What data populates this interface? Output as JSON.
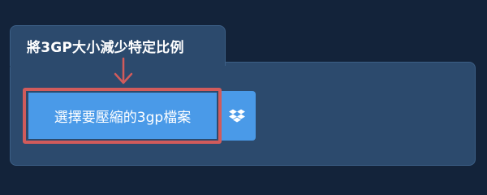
{
  "tab": {
    "title": "將3GP大小減少特定比例"
  },
  "upload": {
    "choose_label": "選擇要壓縮的3gp檔案",
    "dropbox_icon": "dropbox-icon"
  },
  "colors": {
    "page_background": "#13233a",
    "panel_background": "#2c4a6d",
    "button_blue": "#4a9ae8",
    "highlight_red": "#d15b5b"
  }
}
